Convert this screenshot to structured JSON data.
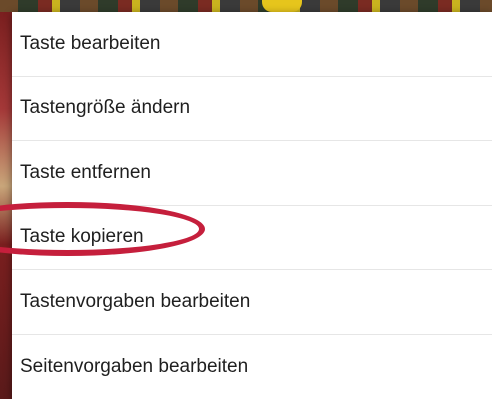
{
  "context_menu": {
    "items": [
      {
        "id": "edit_key",
        "label": "Taste bearbeiten"
      },
      {
        "id": "resize_key",
        "label": "Tastengröße ändern"
      },
      {
        "id": "remove_key",
        "label": "Taste entfernen"
      },
      {
        "id": "copy_key",
        "label": "Taste kopieren",
        "highlighted": true
      },
      {
        "id": "edit_key_presets",
        "label": "Tastenvorgaben bearbeiten"
      },
      {
        "id": "edit_page_presets",
        "label": "Seitenvorgaben bearbeiten"
      }
    ]
  },
  "annotation": {
    "highlight_color": "#c51f3c",
    "highlight_target": "copy_key"
  }
}
